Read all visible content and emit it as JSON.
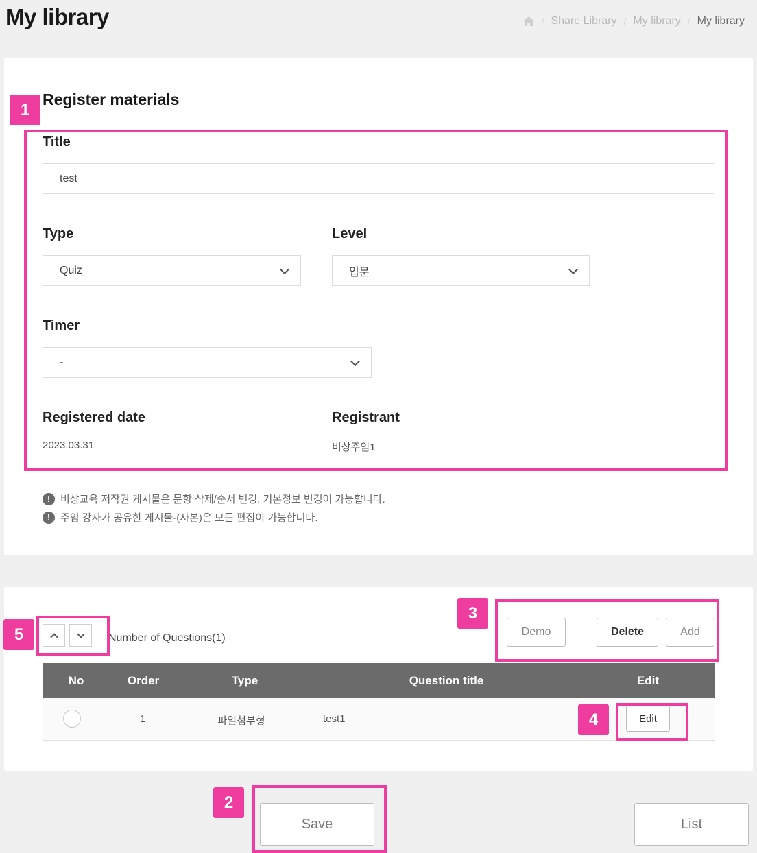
{
  "page": {
    "title": "My library",
    "breadcrumb": [
      "Share Library",
      "My library",
      "My library"
    ]
  },
  "form": {
    "section_title": "Register materials",
    "title_label": "Title",
    "title_value": "test",
    "type_label": "Type",
    "type_value": "Quiz",
    "level_label": "Level",
    "level_value": "입문",
    "timer_label": "Timer",
    "timer_value": "-",
    "registered_date_label": "Registered date",
    "registered_date_value": "2023.03.31",
    "registrant_label": "Registrant",
    "registrant_value": "비상주임1"
  },
  "notices": [
    "비상교육 저작권 게시물은 문항 삭제/순서 변경, 기본정보 변경이 가능합니다.",
    "주임 강사가 공유한 게시물-(사본)은 모든 편집이 가능합니다."
  ],
  "questions": {
    "count_label": "Number of Questions(1)",
    "buttons": {
      "demo": "Demo",
      "delete": "Delete",
      "add": "Add"
    },
    "columns": [
      "No",
      "Order",
      "Type",
      "Question title",
      "Edit"
    ],
    "rows": [
      {
        "order": "1",
        "type": "파일첨부형",
        "title": "test1",
        "edit": "Edit"
      }
    ]
  },
  "footer": {
    "save": "Save",
    "list": "List"
  },
  "annotations": [
    "1",
    "2",
    "3",
    "4",
    "5"
  ],
  "colors": {
    "highlight": "#ee3c9f",
    "table_header": "#6b6b6b"
  }
}
